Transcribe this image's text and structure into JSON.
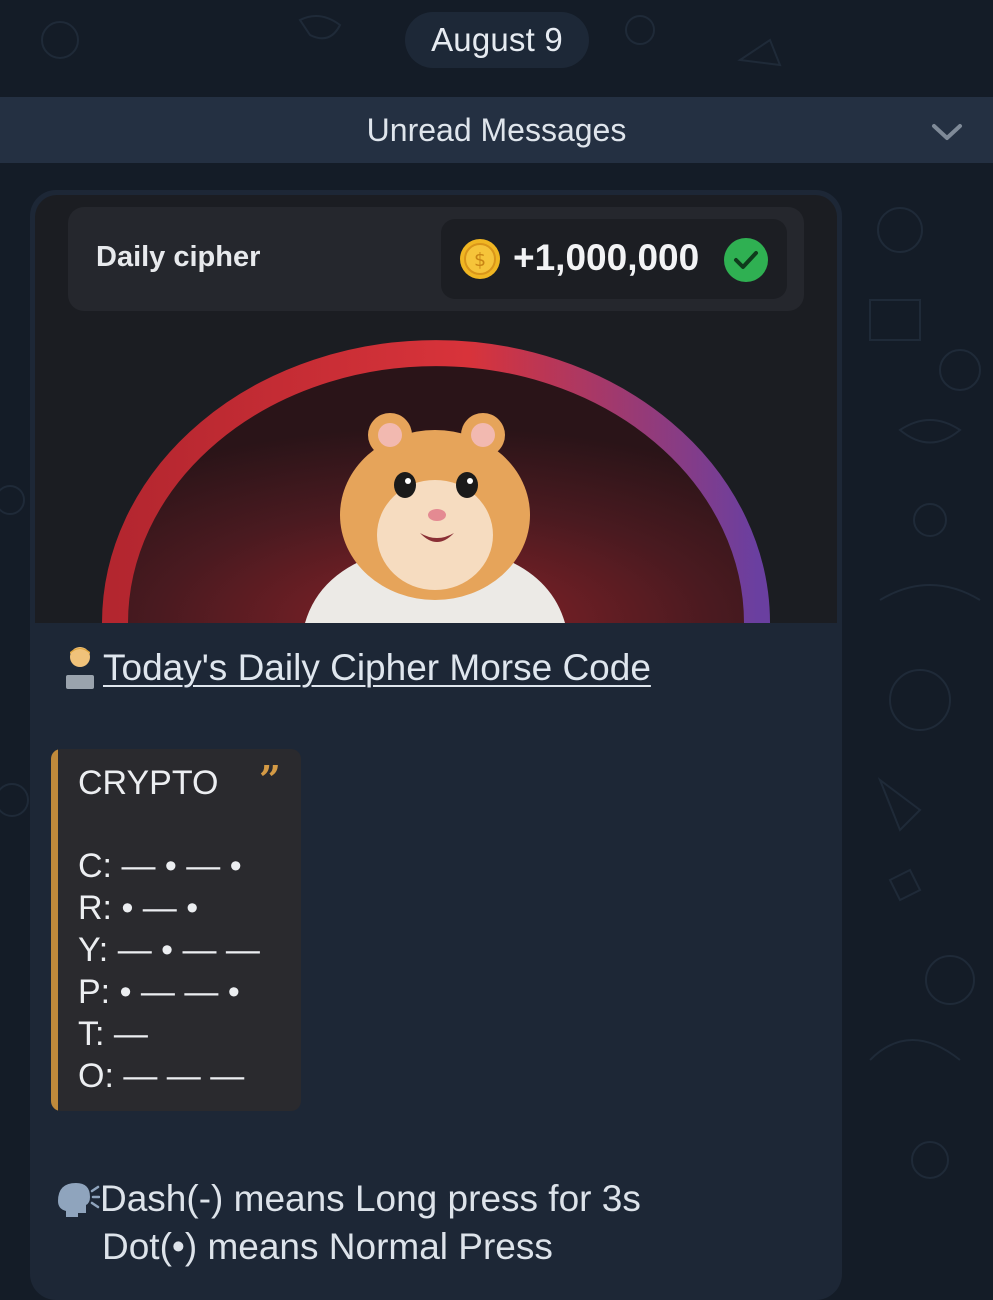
{
  "chat": {
    "date_label": "August 9",
    "unread_label": "Unread Messages"
  },
  "preview": {
    "title": "Daily cipher",
    "reward": "+1,000,000",
    "coin_icon": "coin-icon",
    "check_icon": "check-circle-icon",
    "accent_green": "#2fb052",
    "arc_color": "#c42a33"
  },
  "message": {
    "heading_emoji": "person-with-laptop-icon",
    "heading": "Today's Daily Cipher Morse Code",
    "quote_word": "CRYPTO",
    "codes": [
      "C: — • — •",
      "R: • — •",
      "Y: — • — —",
      "P: • — — •",
      "T: —",
      "O: — — —"
    ],
    "note_icon": "speaking-head-icon",
    "note_line1": "Dash(-) means Long press for 3s",
    "note_line2": "Dot(•) means Normal Press"
  }
}
